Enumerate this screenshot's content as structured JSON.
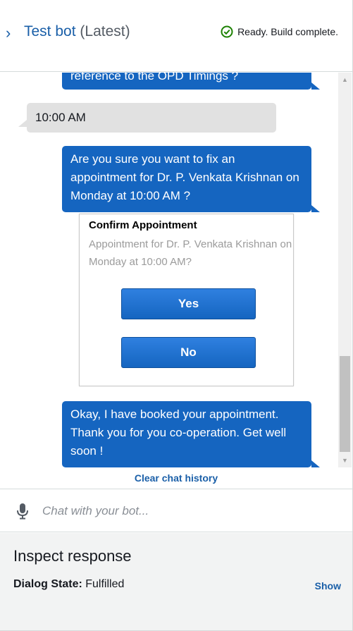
{
  "header": {
    "chevron": "›",
    "bot_name": "Test bot",
    "bot_version": "(Latest)",
    "status_text": "Ready. Build complete.",
    "status_color": "#1d8102"
  },
  "chat": {
    "messages": [
      {
        "sender": "bot",
        "text": "reference to the OPD Timings ?"
      },
      {
        "sender": "user",
        "text": "10:00 AM"
      },
      {
        "sender": "bot",
        "text": "Are you sure you want to fix an appointment for Dr. P. Venkata Krishnan on Monday at 10:00 AM ?"
      },
      {
        "sender": "bot",
        "text": "Okay, I have booked your appointment. Thank you for you co-operation. Get well soon !"
      }
    ],
    "card": {
      "title": "Confirm Appointment",
      "subtitle": "Appointment for Dr. P. Venkata Krishnan on Monday at 10:00 AM?",
      "buttons": [
        "Yes",
        "No"
      ]
    },
    "clear_label": "Clear chat history",
    "bot_bubble_color": "#1565c0",
    "user_bubble_color": "#e1e1e1"
  },
  "input": {
    "placeholder": "Chat with your bot...",
    "value": ""
  },
  "inspect": {
    "title": "Inspect response",
    "dialog_state_label": "Dialog State:",
    "dialog_state_value": "Fulfilled",
    "show_label": "Show"
  }
}
